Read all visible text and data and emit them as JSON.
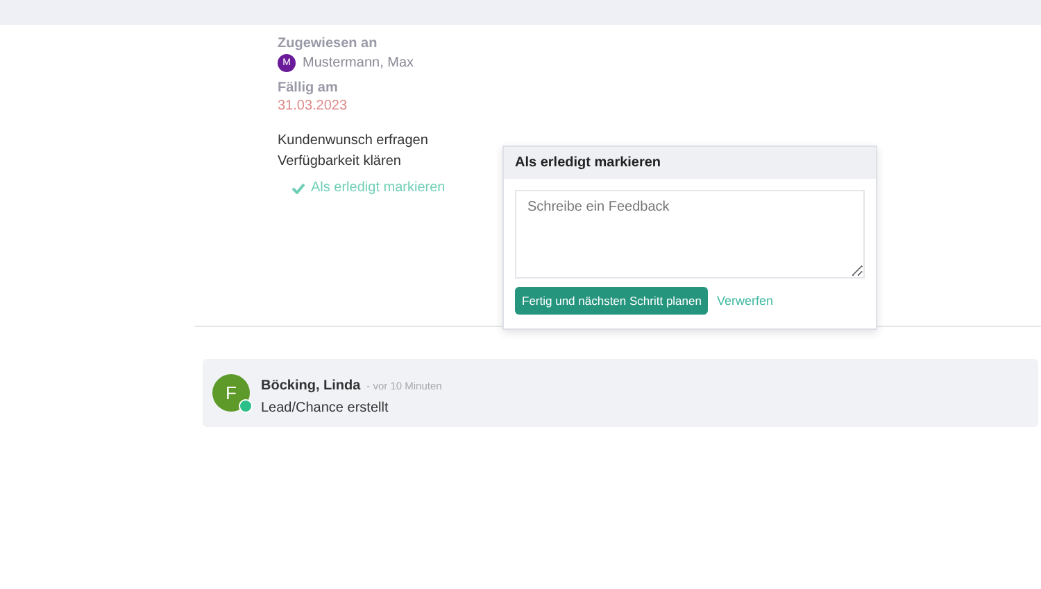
{
  "task": {
    "assigned_label": "Zugewiesen an",
    "assignee": {
      "initial": "M",
      "name": "Mustermann, Max"
    },
    "due_label": "Fällig am",
    "due_date": "31.03.2023",
    "lines": [
      "Kundenwunsch erfragen",
      "Verfügbarkeit klären"
    ],
    "mark_done": "Als erledigt markieren"
  },
  "popover": {
    "title": "Als erledigt markieren",
    "placeholder": "Schreibe ein Feedback",
    "primary": "Fertig und nächsten Schritt planen",
    "secondary": "Verwerfen"
  },
  "activity": [
    {
      "initial": "F",
      "name": "Böcking, Linda",
      "time": "- vor 10 Minuten",
      "text": "Lead/Chance erstellt",
      "online": true
    }
  ]
}
